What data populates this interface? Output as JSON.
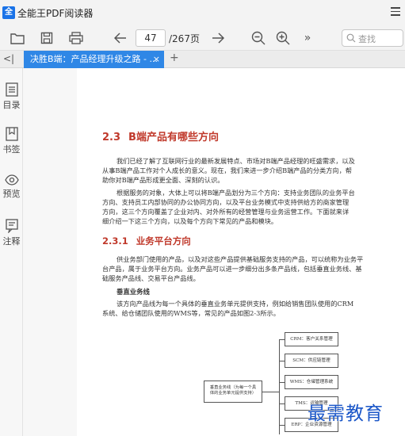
{
  "app": {
    "logo_text": "全",
    "title": "全能王PDF阅读器"
  },
  "toolbar": {
    "page_current": "47",
    "page_total": "/267页",
    "search_placeholder": "查找"
  },
  "tabs": {
    "collapse": "<|",
    "active_tab": "决胜B端：产品经理升级之路 - ...",
    "close": "×",
    "add": "+"
  },
  "sidebar": {
    "items": [
      {
        "label": "目录",
        "icon": "toc-icon"
      },
      {
        "label": "书签",
        "icon": "bookmark-icon"
      },
      {
        "label": "预览",
        "icon": "eye-icon"
      },
      {
        "label": "注释",
        "icon": "annotation-icon"
      }
    ]
  },
  "document": {
    "section_num": "2.3",
    "section_title": "B端产品有哪些方向",
    "p1": [
      "我们已经了解了互联网行业的最新发展特点、市场对B端产品经理的旺盛需求，以及",
      "从事B端产品工作对个人成长的意义。现在，我们来进一步介绍B端产品的分类方向，帮",
      "助你对B端产品形成更全面、深刻的认识。"
    ],
    "p2": [
      "根据服务的对象，大体上可以将B端产品划分为三个方向：支持业务团队的业务平台",
      "方向、支持员工内部协同的办公协同方向，以及平台业务模式中支持供给方的商家管理",
      "方向，这三个方向覆盖了企业对内、对外所有的经营管理与业务运营工作。下面就来详",
      "细介绍一下这三个方向，以及每个方向下常见的产品和模块。"
    ],
    "sub_num": "2.3.1",
    "sub_title": "业务平台方向",
    "p3": [
      "供业务部门使用的产品，以及对这些产品提供基础服务支持的产品，可以统称为业务平",
      "台产品，属于业务平台方向。业务产品可以进一步细分出多条产品线，包括垂直业务线、基",
      "础服务产品线、交易平台产品线。"
    ],
    "subhead": "垂直业务线",
    "p4": [
      "该方向产品线为每一个具体的垂直业务单元提供支持，例如给销售团队使用的CRM",
      "系统、给仓储团队使用的WMS等，常见的产品如图2-3所示。"
    ],
    "diagram": {
      "root": [
        "垂直业务线（为每一个具",
        "体的业务单元提供支持）"
      ],
      "boxes": [
        "CRM：客户关系管理",
        "SCM：供应链管理",
        "WMS：仓储管理系统",
        "TMS：运输管理",
        "ERP：企业资源管理"
      ]
    }
  },
  "watermark": "最需教育",
  "colors": {
    "accent": "#2f87e6",
    "heading": "#c0392b"
  }
}
